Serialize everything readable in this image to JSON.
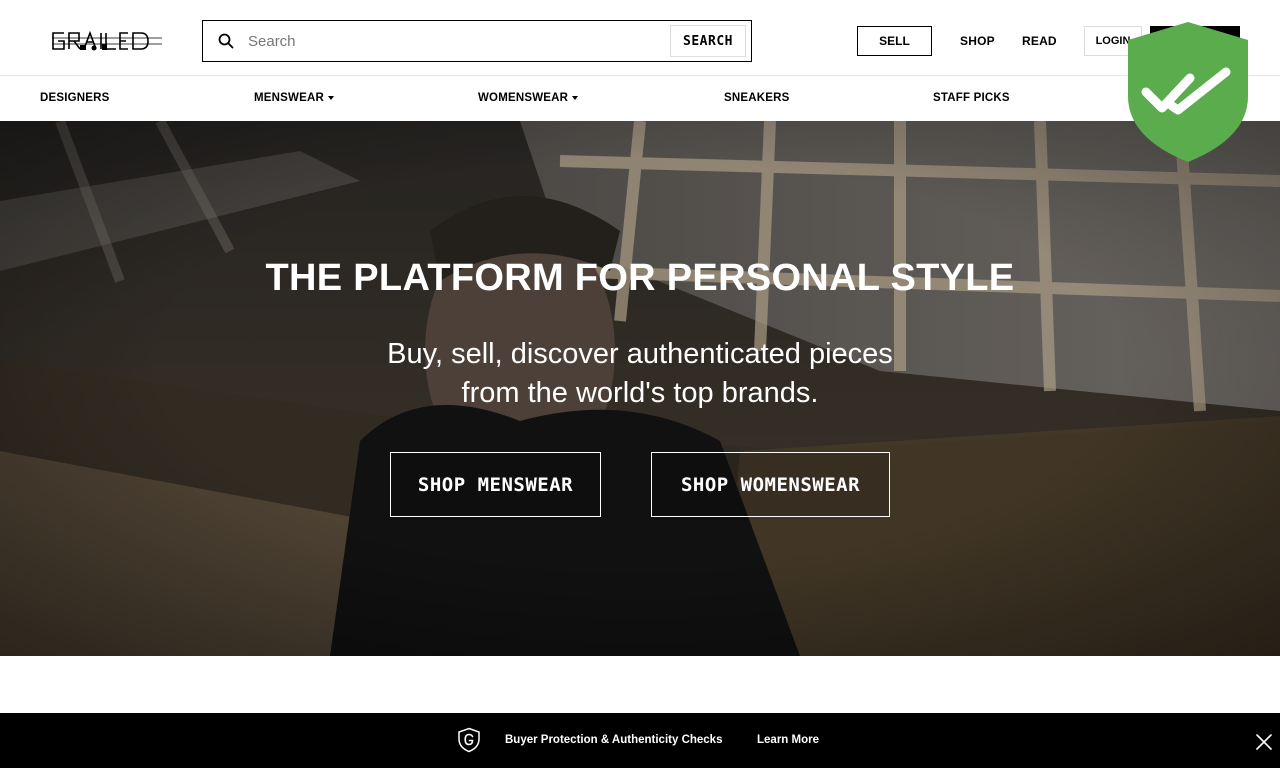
{
  "brand": {
    "logo_text": "GRAILED"
  },
  "search": {
    "placeholder": "Search",
    "button_label": "SEARCH"
  },
  "header_actions": {
    "sell": "SELL",
    "shop": "SHOP",
    "read": "READ",
    "login": "LOGIN"
  },
  "nav": {
    "items": [
      {
        "label": "DESIGNERS",
        "has_dropdown": false
      },
      {
        "label": "MENSWEAR",
        "has_dropdown": true
      },
      {
        "label": "WOMENSWEAR",
        "has_dropdown": true
      },
      {
        "label": "SNEAKERS",
        "has_dropdown": false
      },
      {
        "label": "STAFF PICKS",
        "has_dropdown": false
      }
    ]
  },
  "badge": {
    "icon": "shield-double-check-icon",
    "color": "#5aac4d"
  },
  "hero": {
    "title": "THE PLATFORM FOR PERSONAL STYLE",
    "subtitle_line1": "Buy, sell, discover authenticated pieces",
    "subtitle_line2": "from the world's top brands.",
    "cta_menswear": "SHOP MENSWEAR",
    "cta_womenswear": "SHOP WOMENSWEAR"
  },
  "footer_bar": {
    "icon": "grailed-g-shield-icon",
    "message": "Buyer Protection & Authenticity Checks",
    "link": "Learn More",
    "close_icon": "close-icon"
  },
  "colors": {
    "accent": "#000000",
    "badge_green": "#5aac4d",
    "bar_bg": "#000000"
  }
}
